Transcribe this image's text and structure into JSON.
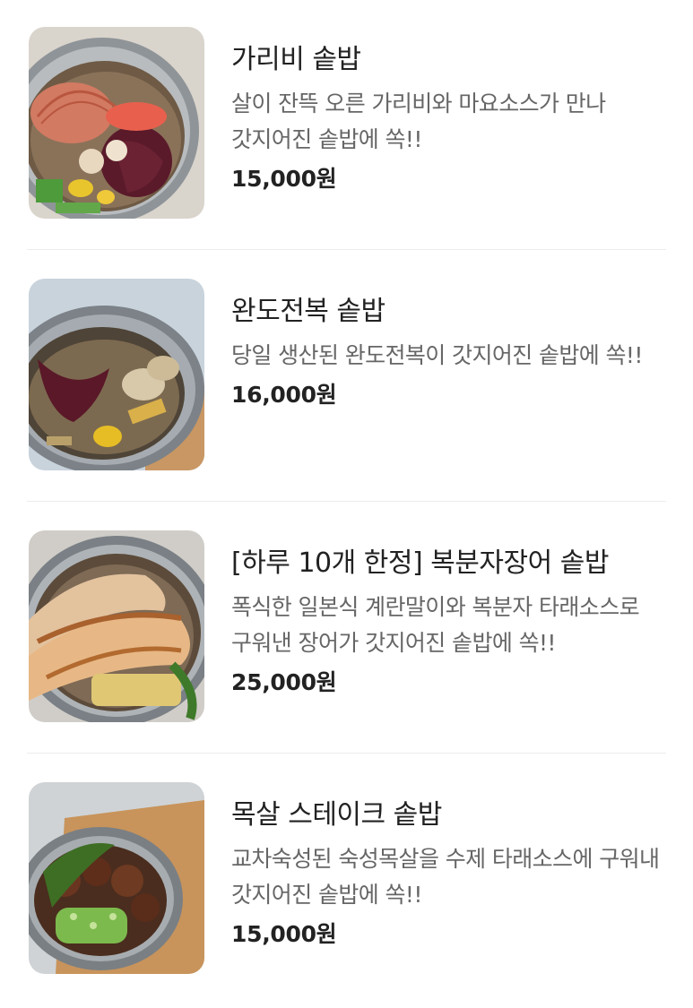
{
  "menu": {
    "items": [
      {
        "name": "가리비 솥밥",
        "description": "살이 잔뜩 오른 가리비와 마요소스가 만나 갓지어진 솥밥에 쏙!!",
        "price": "15,000원",
        "image_icon": "scallop-sotbap-photo"
      },
      {
        "name": "완도전복 솥밥",
        "description": "당일 생산된 완도전복이 갓지어진 솥밥에 쏙!!",
        "price": "16,000원",
        "image_icon": "abalone-sotbap-photo"
      },
      {
        "name": "[하루 10개 한정] 복분자장어 솥밥",
        "description": "폭식한 일본식 계란말이와 복분자 타래소스로 구워낸 장어가 갓지어진 솥밥에 쏙!!",
        "price": "25,000원",
        "image_icon": "eel-sotbap-photo"
      },
      {
        "name": "목살 스테이크 솥밥",
        "description": "교차숙성된 숙성목살을 수제 타래소스에 구워내 갓지어진 솥밥에 쏙!!",
        "price": "15,000원",
        "image_icon": "pork-steak-sotbap-photo"
      }
    ]
  }
}
